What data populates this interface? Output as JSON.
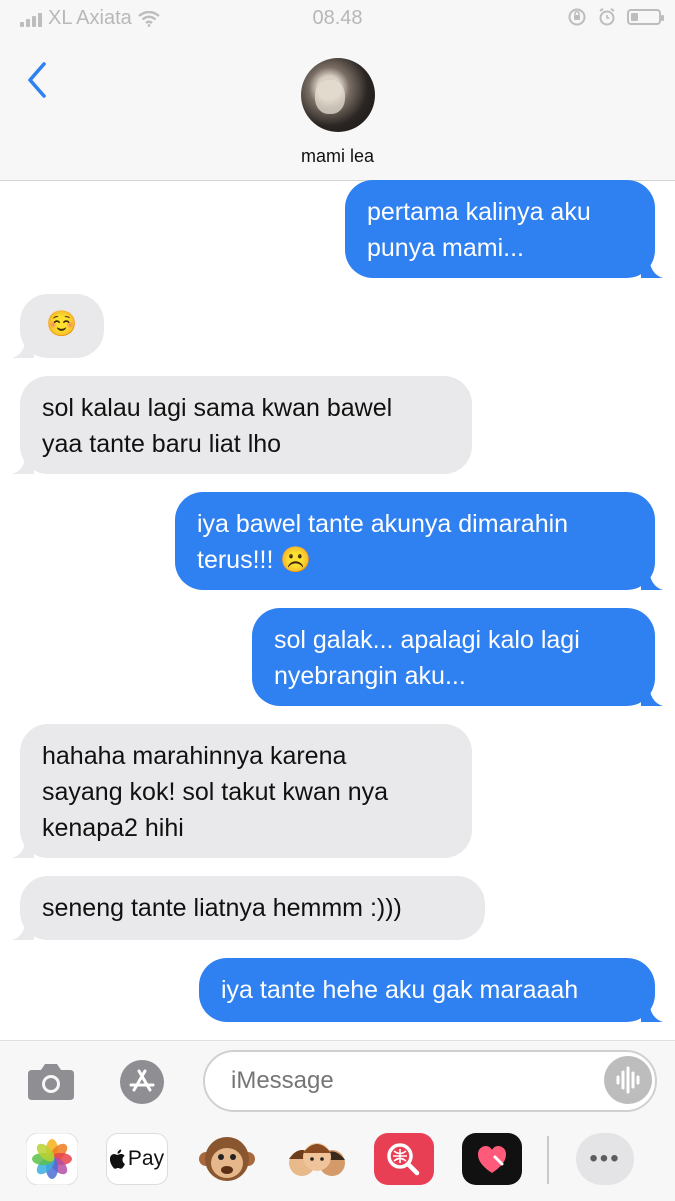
{
  "status_bar": {
    "carrier": "XL Axiata",
    "time": "08.48"
  },
  "header": {
    "contact_name": "mami lea"
  },
  "messages": [
    {
      "from": "me",
      "lines": [
        "pertama kalinya aku",
        "punya mami..."
      ]
    },
    {
      "from": "them",
      "lines": [
        "☺️"
      ]
    },
    {
      "from": "them",
      "lines": [
        "sol kalau lagi sama kwan bawel",
        "yaa tante baru liat lho"
      ]
    },
    {
      "from": "me",
      "lines": [
        "iya bawel tante akunya dimarahin",
        "terus!!! ☹️"
      ]
    },
    {
      "from": "me",
      "lines": [
        "sol galak... apalagi kalo lagi",
        "nyebrangin aku..."
      ]
    },
    {
      "from": "them",
      "lines": [
        "hahaha marahinnya karena",
        "sayang kok! sol takut kwan nya",
        "kenapa2 hihi"
      ]
    },
    {
      "from": "them",
      "lines": [
        "seneng tante liatnya hemmm :)))"
      ]
    },
    {
      "from": "me",
      "lines": [
        "iya tante hehe aku gak maraaah"
      ]
    }
  ],
  "composer": {
    "placeholder": "iMessage"
  },
  "app_drawer": {
    "apple_pay_label": "Pay",
    "more_label": "•••"
  },
  "colors": {
    "sent_bubble": "#2f80f0",
    "received_bubble": "#e9e9eb",
    "accent": "#2f80f0"
  }
}
